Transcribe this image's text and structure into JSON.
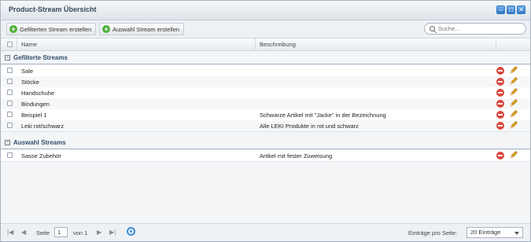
{
  "window": {
    "title": "Product-Stream Übersicht"
  },
  "toolbar": {
    "create_filtered_label": "Gefilterten Stream erstellen",
    "create_selection_label": "Auswahl Stream erstellen",
    "search_placeholder": "Suche..."
  },
  "columns": {
    "name": "Name",
    "description": "Beschreibung"
  },
  "groups": [
    {
      "title": "Gefilterte Streams",
      "rows": [
        {
          "name": "Sale",
          "description": ""
        },
        {
          "name": "Stöcke",
          "description": ""
        },
        {
          "name": "Handschuhe",
          "description": ""
        },
        {
          "name": "Bindungen",
          "description": ""
        },
        {
          "name": "Beispiel 1",
          "description": "Schwarze Artikel mit \"Jacke\" in der Bezeichnung"
        },
        {
          "name": "Leki rot/schwarz",
          "description": "Alle LEKI Produkte in rot und schwarz"
        }
      ]
    },
    {
      "title": "Auswahl Streams",
      "rows": [
        {
          "name": "Sasse Zubehör",
          "description": "Artikel mit fester Zuweisung"
        }
      ]
    }
  ],
  "pagination": {
    "page_label": "Seite",
    "page_value": "1",
    "of_label": "von 1",
    "per_page_label": "Einträge pro Seite:",
    "per_page_value": "20 Einträge"
  },
  "colors": {
    "accent": "#3b8fd9",
    "add": "#4fae3b",
    "delete": "#d9473f",
    "edit": "#e0a020"
  }
}
